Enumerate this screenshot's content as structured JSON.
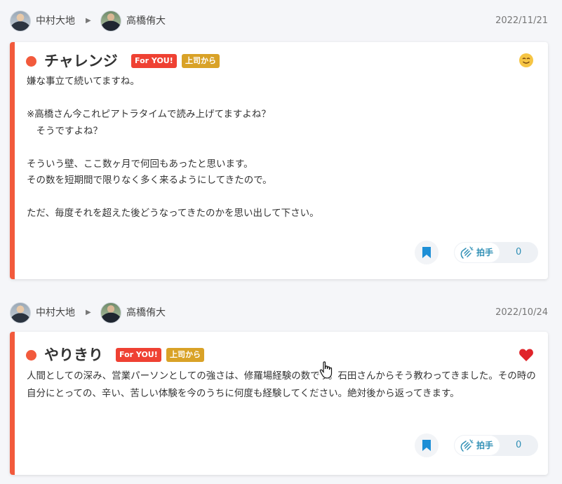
{
  "posts": [
    {
      "from_name": "中村大地",
      "to_name": "高橋侑大",
      "date": "2022/11/21",
      "title": "チャレンジ",
      "badges": [
        "For YOU!",
        "上司から"
      ],
      "body": "嫌な事立て続いてますね。\n\n※高橋さん今これピアトラタイムで読み上げてますよね？\n　そうですよね？\n\nそういう壁、ここ数ヶ月で何回もあったと思います。\nその数を短期間で限りなく多く来るようにしてきたので。\n\nただ、毎度それを超えた後どうなってきたのかを思い出して下さい。",
      "reaction_icon": "smile-emoji-icon",
      "clap_label": "拍手",
      "clap_count": "0"
    },
    {
      "from_name": "中村大地",
      "to_name": "高橋侑大",
      "date": "2022/10/24",
      "title": "やりきり",
      "badges": [
        "For YOU!",
        "上司から"
      ],
      "body": "人間としての深み、営業パーソンとしての強さは、修羅場経験の数です。石田さんからそう教わってきました。その時の自分にとっての、辛い、苦しい体験を今のうちに何度も経験してください。絶対後から返ってきます。",
      "reaction_icon": "heart-icon",
      "clap_label": "拍手",
      "clap_count": "0"
    }
  ],
  "colors": {
    "accent": "#f25a3c",
    "for_you_badge": "#ef4133",
    "boss_badge": "#d9a227",
    "action_blue": "#1e8fd6"
  }
}
